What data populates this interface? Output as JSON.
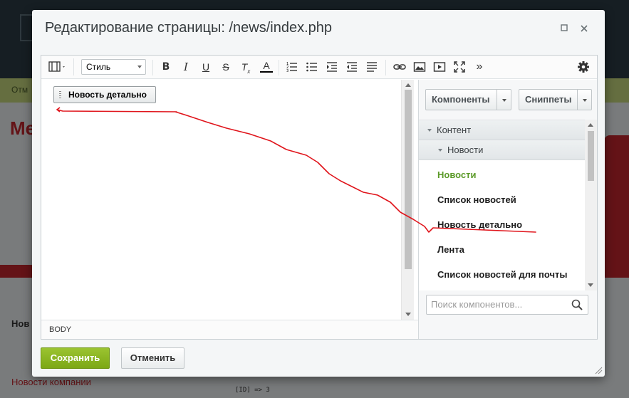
{
  "dialog": {
    "title": "Редактирование страницы: /news/index.php",
    "maximize_icon": "maximize-icon",
    "close_icon": "close-icon"
  },
  "toolbar": {
    "style_select": "Стиль",
    "icons": [
      "view-mode-icon",
      "bold-icon",
      "italic-icon",
      "underline-icon",
      "strikethrough-icon",
      "remove-format-icon",
      "text-color-icon",
      "ordered-list-icon",
      "unordered-list-icon",
      "indent-icon",
      "outdent-icon",
      "align-icon",
      "link-icon",
      "image-icon",
      "video-icon",
      "fullscreen-icon",
      "more-icon",
      "settings-icon"
    ]
  },
  "content": {
    "component_block": "Новость детально"
  },
  "statusbar": {
    "path": "BODY"
  },
  "side": {
    "components_button": "Компоненты",
    "snippets_button": "Сниппеты",
    "category": "Контент",
    "subcategory": "Новости",
    "items": [
      {
        "label": "Новости",
        "active": true
      },
      {
        "label": "Список новостей",
        "active": false
      },
      {
        "label": "Новость детально",
        "active": false
      },
      {
        "label": "Лента",
        "active": false
      },
      {
        "label": "Список новостей для почты",
        "active": false
      }
    ],
    "search_placeholder": "Поиск компонентов..."
  },
  "footer": {
    "save": "Сохранить",
    "cancel": "Отменить"
  },
  "background": {
    "title": "Ме",
    "section": "Нов",
    "news_link": "Новости компании",
    "code": "[ID] => 3",
    "bar": "Отм"
  },
  "colors": {
    "save_green": "#7ca815",
    "active_item": "#5b9a28",
    "annotation": "#e0141b"
  }
}
